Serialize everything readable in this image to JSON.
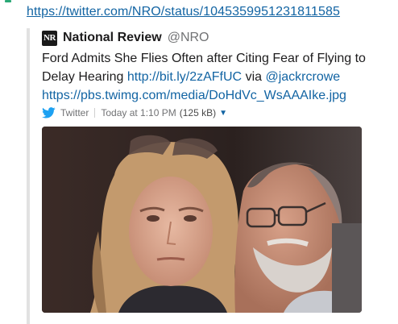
{
  "message": {
    "link": "https://twitter.com/NRO/status/1045359951231811585"
  },
  "attachment": {
    "author_logo": "NR",
    "author_name": "National Review",
    "author_handle": "@NRO",
    "tweet_text": "Ford Admits She Flies Often after Citing Fear of Flying to Delay Hearing",
    "tweet_link": "http://bit.ly/2zAFfUC",
    "via_text": "via",
    "via_handle": "@jackrcrowe",
    "media_link": "https://pbs.twimg.com/media/DoHdVc_WsAAAIke.jpg",
    "service_name": "Twitter",
    "timestamp": "Today at 1:10 PM",
    "file_size": "(125 kB)",
    "service_icon": "twitter-bird-icon",
    "expand_icon": "caret-down-icon"
  },
  "colors": {
    "link": "#1264a3",
    "twitter_blue": "#1da1f2",
    "attachment_border": "#e2e2e2"
  }
}
